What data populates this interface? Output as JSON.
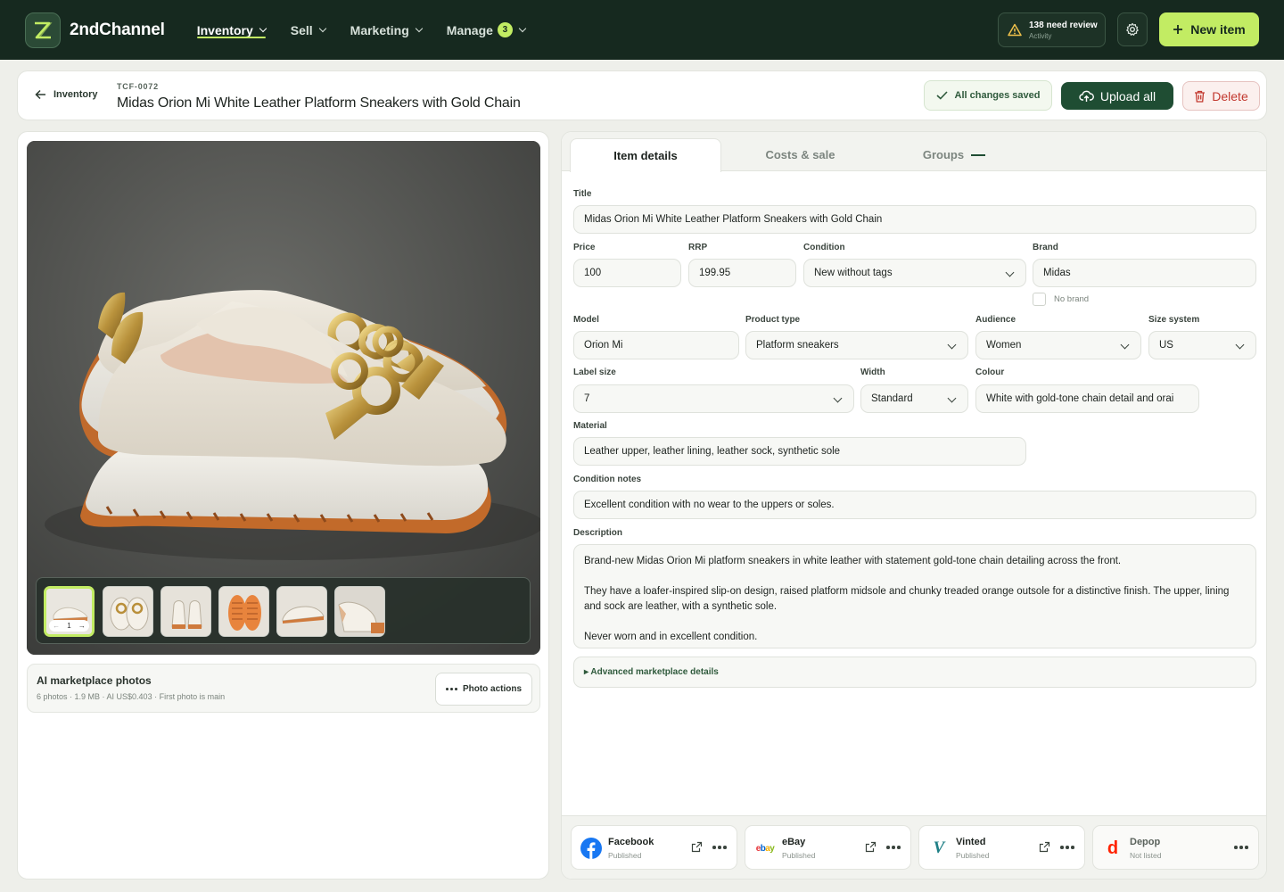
{
  "app": {
    "name": "2ndChannel"
  },
  "nav": {
    "items": [
      {
        "label": "Inventory"
      },
      {
        "label": "Sell"
      },
      {
        "label": "Marketing"
      },
      {
        "label": "Manage",
        "badge": "3"
      }
    ]
  },
  "topbar": {
    "review_title": "138 need review",
    "review_sub": "Activity",
    "new_item": "New item"
  },
  "header": {
    "back_label": "Inventory",
    "sku": "TCF-0072",
    "title": "Midas Orion Mi White Leather Platform Sneakers with Gold Chain",
    "saved": "All changes saved",
    "upload": "Upload all",
    "delete": "Delete"
  },
  "photos": {
    "counter": "1",
    "ai_title": "AI marketplace photos",
    "ai_meta": "6 photos · 1.9 MB · AI US$0.403 · First photo is main",
    "actions": "Photo actions"
  },
  "tabs": [
    {
      "label": "Item details"
    },
    {
      "label": "Costs & sale"
    },
    {
      "label": "Groups"
    }
  ],
  "form": {
    "title_label": "Title",
    "title_value": "Midas Orion Mi White Leather Platform Sneakers with Gold Chain",
    "price_label": "Price",
    "price_value": "100",
    "rrp_label": "RRP",
    "rrp_value": "199.95",
    "condition_label": "Condition",
    "condition_value": "New without tags",
    "brand_label": "Brand",
    "brand_value": "Midas",
    "no_brand": "No brand",
    "model_label": "Model",
    "model_value": "Orion Mi",
    "product_type_label": "Product type",
    "product_type_value": "Platform sneakers",
    "audience_label": "Audience",
    "audience_value": "Women",
    "size_system_label": "Size system",
    "size_system_value": "US",
    "label_size_label": "Label size",
    "label_size_value": "7",
    "width_label": "Width",
    "width_value": "Standard",
    "colour_label": "Colour",
    "colour_value": "White with gold-tone chain detail and orai",
    "material_label": "Material",
    "material_value": "Leather upper, leather lining, leather sock, synthetic sole",
    "condition_notes_label": "Condition notes",
    "condition_notes_value": "Excellent condition with no wear to the uppers or soles.",
    "description_label": "Description",
    "description_p1": "Brand-new Midas Orion Mi platform sneakers in white leather with statement gold-tone chain detailing across the front.",
    "description_p2": "They have a loafer-inspired slip-on design, raised platform midsole and chunky treaded orange outsole for a distinctive finish. The upper, lining and sock are leather, with a synthetic sole.",
    "description_p3": "Never worn and in excellent condition.",
    "advanced": "▸ Advanced marketplace details"
  },
  "marketplaces": [
    {
      "name": "Facebook",
      "status": "Published",
      "color": "#1877f2"
    },
    {
      "name": "eBay",
      "status": "Published"
    },
    {
      "name": "Vinted",
      "status": "Published",
      "color": "#1f7f86"
    },
    {
      "name": "Depop",
      "status": "Not listed",
      "color": "#ff2300"
    }
  ],
  "colors": {
    "accent": "#c2ec63",
    "nav_bg": "#16291f",
    "primary": "#1f4d33",
    "danger": "#c2392f"
  }
}
